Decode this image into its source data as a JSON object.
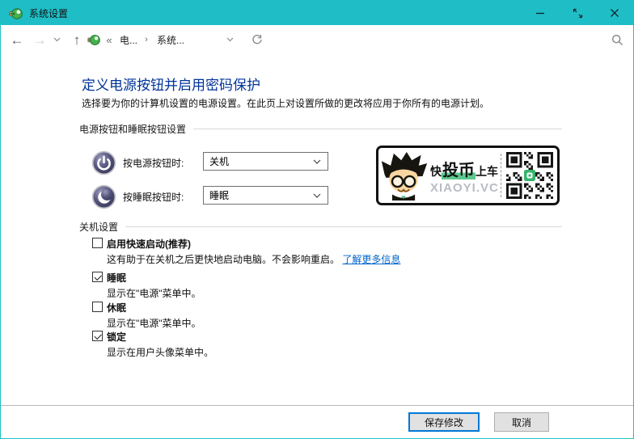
{
  "window": {
    "title": "系统设置"
  },
  "nav": {
    "back_icon": "←",
    "forward_icon": "→",
    "up_icon": "↑",
    "breadcrumb": {
      "overflow": "«",
      "item1": "电...",
      "separator": "›",
      "item2": "系统..."
    }
  },
  "page": {
    "title": "定义电源按钮并启用密码保护",
    "subtitle": "选择要为你的计算机设置的电源设置。在此页上对设置所做的更改将应用于你所有的电源计划。"
  },
  "sections": {
    "power_buttons": "电源按钮和睡眠按钮设置",
    "shutdown": "关机设置"
  },
  "power_settings": [
    {
      "label": "按电源按钮时:",
      "value": "关机"
    },
    {
      "label": "按睡眠按钮时:",
      "value": "睡眠"
    }
  ],
  "watermark": {
    "line1_pre": "快",
    "line1_em": "投币",
    "line1_post": "上车",
    "site": "XIAOYI.VC"
  },
  "shutdown_options": [
    {
      "label": "启用快速启动(推荐)",
      "checked": false,
      "description": "这有助于在关机之后更快地启动电脑。不会影响重启。",
      "link": "了解更多信息"
    },
    {
      "label": "睡眠",
      "checked": true,
      "description": "显示在\"电源\"菜单中。"
    },
    {
      "label": "休眠",
      "checked": false,
      "description": "显示在\"电源\"菜单中。"
    },
    {
      "label": "锁定",
      "checked": true,
      "description": "显示在用户头像菜单中。"
    }
  ],
  "footer": {
    "save_label": "保存修改",
    "cancel_label": "取消"
  },
  "colors": {
    "titlebar": "#1fbec6",
    "heading": "#003399",
    "link": "#0066cc",
    "default_button_border": "#0078d7",
    "icon_circle": "#4e4e75"
  }
}
